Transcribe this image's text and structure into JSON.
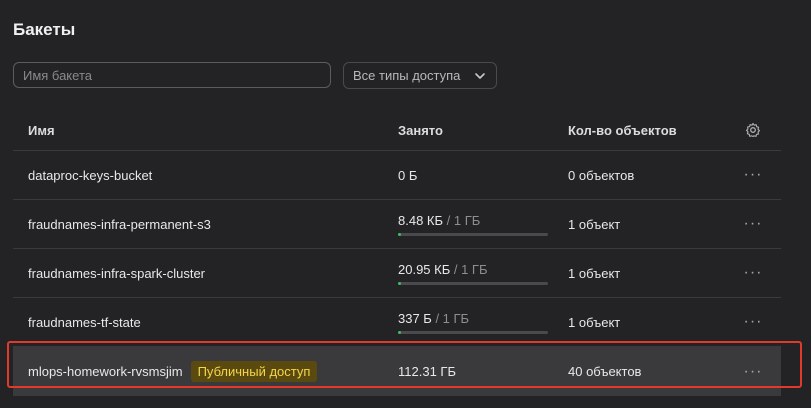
{
  "page": {
    "title": "Бакеты"
  },
  "filters": {
    "search_placeholder": "Имя бакета",
    "search_value": "",
    "access_type_selected": "Все типы доступа"
  },
  "table": {
    "columns": {
      "name": "Имя",
      "size": "Занято",
      "count": "Кол-во объектов"
    },
    "rows": [
      {
        "name": "dataproc-keys-bucket",
        "size": "0 Б",
        "limit": "",
        "usage_fraction": 0,
        "count": "0 объектов",
        "badge": ""
      },
      {
        "name": "fraudnames-infra-permanent-s3",
        "size": "8.48 КБ",
        "limit": " / 1 ГБ",
        "usage_fraction": 1e-05,
        "count": "1 объект",
        "badge": ""
      },
      {
        "name": "fraudnames-infra-spark-cluster",
        "size": "20.95 КБ",
        "limit": " / 1 ГБ",
        "usage_fraction": 2e-05,
        "count": "1 объект",
        "badge": ""
      },
      {
        "name": "fraudnames-tf-state",
        "size": "337 Б",
        "limit": " / 1 ГБ",
        "usage_fraction": 3e-07,
        "count": "1 объект",
        "badge": ""
      },
      {
        "name": "mlops-homework-rvsmsjim",
        "size": "112.31 ГБ",
        "limit": "",
        "usage_fraction": 0,
        "count": "40 объектов",
        "badge": "Публичный доступ"
      }
    ]
  },
  "colors": {
    "progress_fill": "#3bbf5e",
    "badge_text": "#f6d54a",
    "highlight_border": "#e03a2c"
  },
  "icons": {
    "settings": "gear-icon",
    "row_actions": "more-horizontal-icon",
    "select_arrow": "chevron-down-icon"
  }
}
